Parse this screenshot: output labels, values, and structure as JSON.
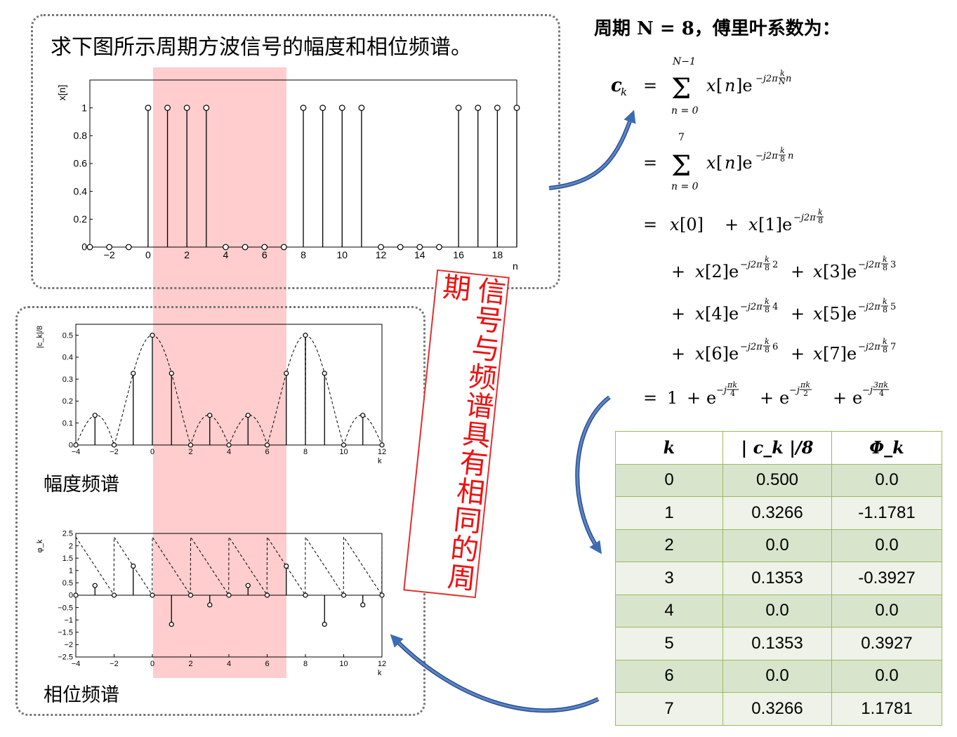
{
  "title": "求下图所示周期方波信号的幅度和相位频谱。",
  "rhs_heading": "周期 N = 8，傅里叶系数为：",
  "label_magnitude": "幅度频谱",
  "label_phase": "相位频谱",
  "vertical_note": "信号与频谱具有相同的周期",
  "highlight_color": "#ffc4c4",
  "table": {
    "headers": [
      "k",
      "| c_k |/8",
      "Φ_k"
    ],
    "rows": [
      [
        "0",
        "0.500",
        "0.0"
      ],
      [
        "1",
        "0.3266",
        "-1.1781"
      ],
      [
        "2",
        "0.0",
        "0.0"
      ],
      [
        "3",
        "0.1353",
        "-0.3927"
      ],
      [
        "4",
        "0.0",
        "0.0"
      ],
      [
        "5",
        "0.1353",
        "0.3927"
      ],
      [
        "6",
        "0.0",
        "0.0"
      ],
      [
        "7",
        "0.3266",
        "1.1781"
      ]
    ],
    "border_color": "#9bbb59"
  },
  "chart_data": [
    {
      "type": "stem",
      "ylabel": "x[n]",
      "xlabel": "n",
      "xlim": [
        -3,
        19
      ],
      "ylim": [
        0,
        1.2
      ],
      "xticks": [
        -2,
        0,
        2,
        4,
        6,
        8,
        10,
        12,
        14,
        16,
        18
      ],
      "yticks": [
        0,
        0.2,
        0.4,
        0.6,
        0.8,
        1
      ],
      "x": [
        -3,
        -2,
        -1,
        0,
        1,
        2,
        3,
        4,
        5,
        6,
        7,
        8,
        9,
        10,
        11,
        12,
        13,
        14,
        15,
        16,
        17,
        18,
        19
      ],
      "y": [
        0,
        0,
        0,
        1,
        1,
        1,
        1,
        0,
        0,
        0,
        0,
        1,
        1,
        1,
        1,
        0,
        0,
        0,
        0,
        1,
        1,
        1,
        1
      ]
    },
    {
      "type": "stem",
      "ylabel": "|c_k|/8",
      "xlabel": "k",
      "xlim": [
        -4,
        12
      ],
      "ylim": [
        0,
        0.55
      ],
      "xticks": [
        -4,
        -2,
        0,
        2,
        4,
        6,
        8,
        10,
        12
      ],
      "yticks": [
        0,
        0.1,
        0.2,
        0.3,
        0.4,
        0.5
      ],
      "x": [
        -4,
        -3,
        -2,
        -1,
        0,
        1,
        2,
        3,
        4,
        5,
        6,
        7,
        8,
        9,
        10,
        11,
        12
      ],
      "y": [
        0,
        0.1353,
        0,
        0.3266,
        0.5,
        0.3266,
        0,
        0.1353,
        0,
        0.1353,
        0,
        0.3266,
        0.5,
        0.3266,
        0,
        0.1353,
        0
      ]
    },
    {
      "type": "stem",
      "ylabel": "φ_k",
      "xlabel": "k",
      "xlim": [
        -4,
        12
      ],
      "ylim": [
        -2.5,
        2.5
      ],
      "xticks": [
        -4,
        -2,
        0,
        2,
        4,
        6,
        8,
        10,
        12
      ],
      "yticks": [
        2.5,
        2,
        1.5,
        1,
        0.5,
        0,
        -0.5,
        -1,
        -1.5,
        -2,
        -2.5
      ],
      "ytick_labels": [
        "2.5",
        "2",
        "1.5",
        "1",
        "0.5",
        "0",
        "−0.5",
        "−1",
        "−1.5",
        "−2",
        "−2.5"
      ],
      "x": [
        -4,
        -3,
        -2,
        -1,
        0,
        1,
        2,
        3,
        4,
        5,
        6,
        7,
        8,
        9,
        10,
        11,
        12
      ],
      "y": [
        0,
        0.3927,
        0,
        1.1781,
        0,
        -1.1781,
        0,
        -0.3927,
        0,
        0.3927,
        0,
        1.1781,
        0,
        -1.1781,
        0,
        -0.3927,
        0
      ]
    }
  ]
}
